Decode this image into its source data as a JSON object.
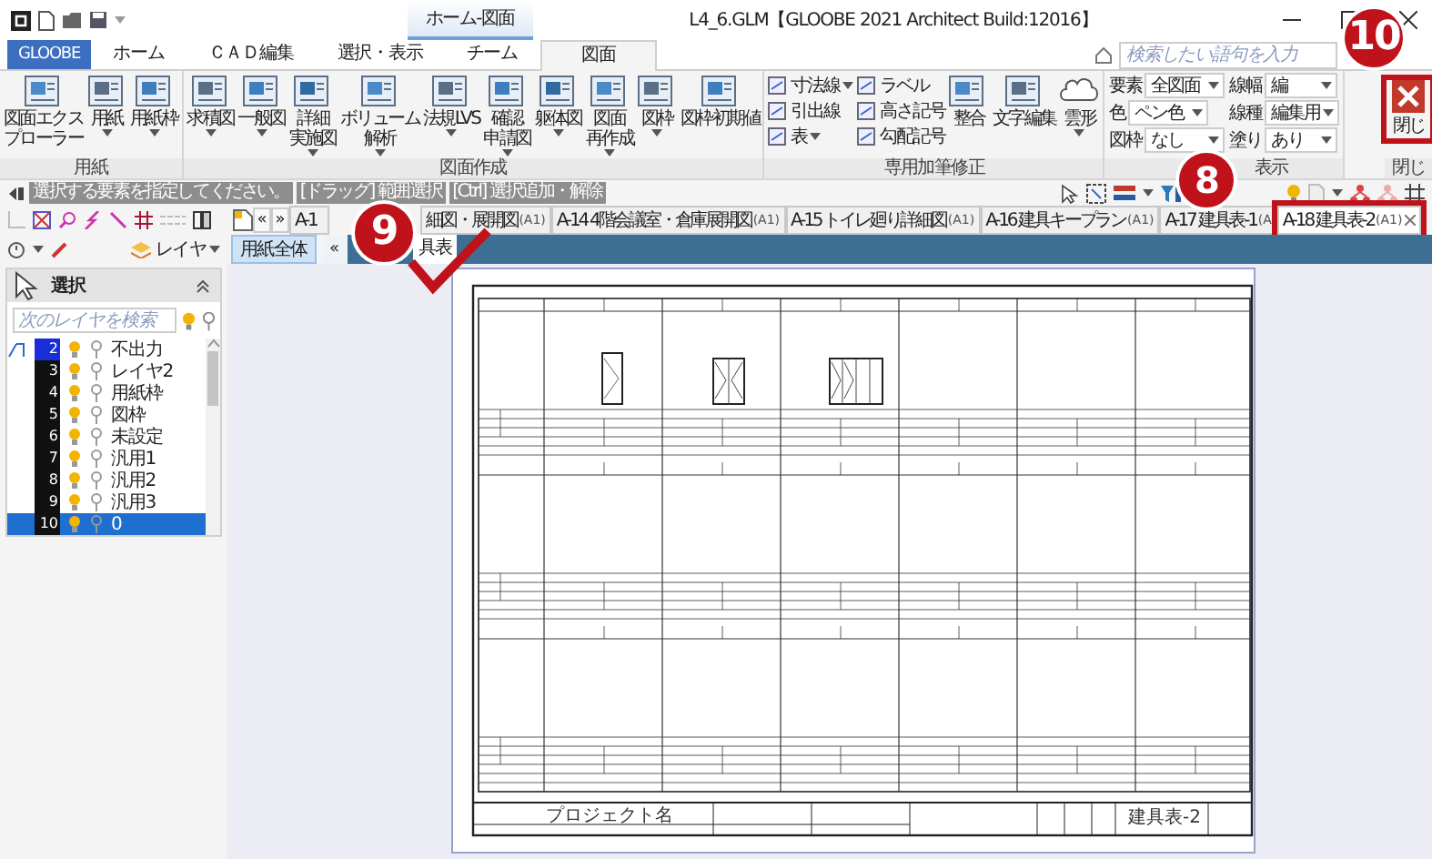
{
  "title_bar": {
    "context_tab": "ホーム-図面",
    "title": "L4_6.GLM【GLOOBE 2021 Architect Build:12016】"
  },
  "ribbon_tabs": [
    {
      "label": "GLOOBE",
      "kind": "app",
      "selected": false
    },
    {
      "label": "ホーム",
      "kind": "tab",
      "selected": false
    },
    {
      "label": "ＣＡＤ編集",
      "kind": "tab",
      "selected": false
    },
    {
      "label": "選択・表示",
      "kind": "tab",
      "selected": false
    },
    {
      "label": "チーム",
      "kind": "tab",
      "selected": false
    },
    {
      "label": "図面",
      "kind": "tab",
      "selected": true
    }
  ],
  "search": {
    "placeholder": "検索したい語句を入力"
  },
  "ribbon_groups": [
    {
      "label": "用紙",
      "items": [
        {
          "kind": "large",
          "label": [
            "図面エクス",
            "プローラー"
          ],
          "dropdown": false
        },
        {
          "kind": "large",
          "label": [
            "用紙"
          ],
          "dropdown": true
        },
        {
          "kind": "large",
          "label": [
            "用紙枠"
          ],
          "dropdown": true
        }
      ]
    },
    {
      "label": "図面作成",
      "items": [
        {
          "kind": "large",
          "label": [
            "求積図"
          ],
          "dropdown": true
        },
        {
          "kind": "large",
          "label": [
            "一般図"
          ],
          "dropdown": true
        },
        {
          "kind": "large",
          "label": [
            "詳細",
            "実施図"
          ],
          "dropdown": true
        },
        {
          "kind": "large",
          "label": [
            "ボリューム",
            "解析"
          ],
          "dropdown": true
        },
        {
          "kind": "large",
          "label": [
            "法規LVS"
          ],
          "dropdown": true
        },
        {
          "kind": "large",
          "label": [
            "確認",
            "申請図"
          ],
          "dropdown": true
        },
        {
          "kind": "large",
          "label": [
            "躯体図"
          ],
          "dropdown": true
        },
        {
          "kind": "large",
          "label": [
            "図面",
            "再作成"
          ],
          "dropdown": true
        },
        {
          "kind": "large",
          "label": [
            "図枠"
          ],
          "dropdown": true
        },
        {
          "kind": "large",
          "label": [
            "図枠初期値"
          ],
          "dropdown": false
        }
      ]
    },
    {
      "label": "専用加筆修正",
      "items": [
        {
          "kind": "stack",
          "buttons": [
            {
              "label": "寸法線",
              "dropdown": true
            },
            {
              "label": "引出線",
              "dropdown": false
            },
            {
              "label": "表",
              "dropdown": true
            }
          ]
        },
        {
          "kind": "stack",
          "buttons": [
            {
              "label": "ラベル",
              "dropdown": false
            },
            {
              "label": "高さ記号",
              "dropdown": false
            },
            {
              "label": "勾配記号",
              "dropdown": false
            }
          ]
        },
        {
          "kind": "large",
          "label": [
            "整合"
          ],
          "dropdown": false
        },
        {
          "kind": "large",
          "label": [
            "文字編集"
          ],
          "dropdown": false
        },
        {
          "kind": "large",
          "label": [
            "雲形"
          ],
          "dropdown": true
        }
      ]
    },
    {
      "label": "表示",
      "items": [
        {
          "kind": "fields",
          "fields": [
            {
              "label": "要素",
              "value": "全図面"
            },
            {
              "label": "色",
              "value": "ペン色"
            },
            {
              "label": "図枠",
              "value": "なし"
            }
          ]
        },
        {
          "kind": "fields",
          "fields": [
            {
              "label": "線幅",
              "value": "編"
            },
            {
              "label": "線種",
              "value": "編集用"
            },
            {
              "label": "塗り",
              "value": "あり"
            }
          ]
        }
      ]
    }
  ],
  "close_group": {
    "label": "閉じ",
    "button": {
      "label": "閉じ",
      "highlighted": true
    }
  },
  "hints": [
    "選択する要素を指定してください。",
    "[ドラッグ] 範囲選択",
    "[Ctrl] 選択追加・解除"
  ],
  "layer_panel": {
    "dropdown": "レイヤ",
    "title": "選択",
    "search_placeholder": "次のレイヤを検索",
    "layers": [
      {
        "number": "2",
        "name": "不出力",
        "current": true,
        "selected": false
      },
      {
        "number": "3",
        "name": "レイヤ2",
        "current": false,
        "selected": false
      },
      {
        "number": "4",
        "name": "用紙枠",
        "current": false,
        "selected": false
      },
      {
        "number": "5",
        "name": "図枠",
        "current": false,
        "selected": false
      },
      {
        "number": "6",
        "name": "未設定",
        "current": false,
        "selected": false
      },
      {
        "number": "7",
        "name": "汎用1",
        "current": false,
        "selected": false
      },
      {
        "number": "8",
        "name": "汎用2",
        "current": false,
        "selected": false
      },
      {
        "number": "9",
        "name": "汎用3",
        "current": false,
        "selected": false
      },
      {
        "number": "10",
        "name": "0",
        "current": false,
        "selected": true
      }
    ]
  },
  "doc_tab_nav": [
    "«",
    "»"
  ],
  "doc_tabs": [
    {
      "label": "A-1",
      "selected": false,
      "highlighted": false
    },
    {
      "label": "細図・展開図",
      "sheet": "(A1)",
      "selected": false,
      "highlighted": false
    },
    {
      "label": "A-14 4階会議室・倉庫展開図",
      "sheet": "(A1)",
      "selected": false,
      "highlighted": false
    },
    {
      "label": "A-15 トイレ廻り詳細図",
      "sheet": "(A1)",
      "selected": false,
      "highlighted": false
    },
    {
      "label": "A-16 建具キープラン",
      "sheet": "(A1)",
      "selected": false,
      "highlighted": false
    },
    {
      "label": "A-17 建具表-1",
      "sheet": "(A",
      "selected": false,
      "highlighted": false
    },
    {
      "label": "A-18 建具表-2",
      "sheet": "(A1)",
      "selected": true,
      "highlighted": true
    }
  ],
  "sheet_bar": {
    "button": "用紙全体",
    "nav": "«",
    "tab": "具表"
  },
  "sheet": {
    "project": "プロジェクト名",
    "drawing_title": "建具表-2"
  },
  "callouts": [
    {
      "number": "10",
      "check": false
    },
    {
      "number": "8",
      "check": false
    },
    {
      "number": "9",
      "check": true
    }
  ]
}
